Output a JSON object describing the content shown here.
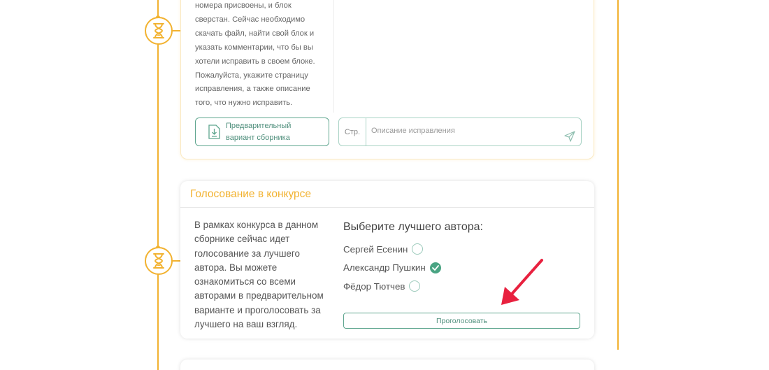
{
  "colors": {
    "accent": "#f2b230",
    "green": "#4aa483",
    "arrow": "#e8213f"
  },
  "top_card": {
    "text": "номера присвоены, и блок сверстан. Сейчас необходимо скачать файл, найти свой блок и указать комментарии, что бы вы хотели исправить в своем блоке. Пожалуйста, укажите страницу исправления, а также описание того, что нужно исправить.",
    "preview_button_line1": "Предварительный",
    "preview_button_line2": "вариант сборника",
    "page_field_placeholder": "Стр.",
    "description_placeholder": "Описание исправления"
  },
  "vote_card": {
    "title": "Голосование в конкурсе",
    "text": "В рамках конкурса в данном сборнике сейчас идет голосование за лучшего автора. Вы можете ознакомиться со всеми авторами в предварительном варианте и проголосовать за лучшего на ваш взгляд.",
    "prompt": "Выберите лучшего автора:",
    "options": [
      {
        "label": "Сергей Есенин",
        "selected": false
      },
      {
        "label": "Александр Пушкин",
        "selected": true
      },
      {
        "label": "Фёдор Тютчев",
        "selected": false
      }
    ],
    "vote_button": "Проголосовать"
  },
  "icons": {
    "timeline": "hourglass-icon",
    "download": "download-document-icon",
    "send": "send-icon",
    "check": "check-icon",
    "annotation": "red-arrow-icon"
  }
}
